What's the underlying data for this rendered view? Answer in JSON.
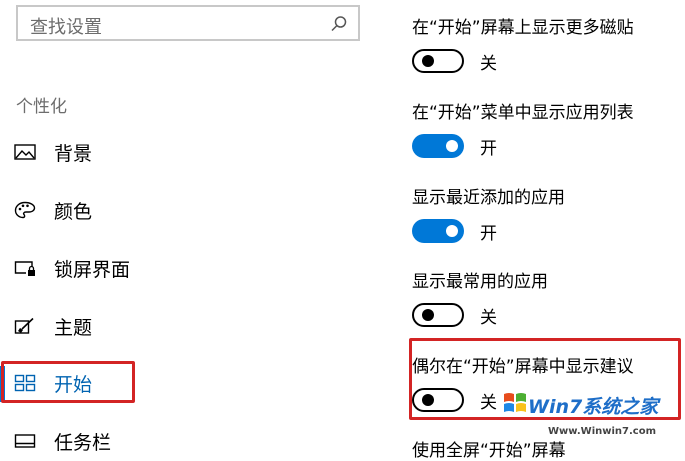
{
  "search": {
    "placeholder": "查找设置",
    "icon": "search-icon"
  },
  "sidebar": {
    "section_title": "个性化",
    "items": [
      {
        "label": "背景",
        "icon": "picture-icon"
      },
      {
        "label": "颜色",
        "icon": "palette-icon"
      },
      {
        "label": "锁屏界面",
        "icon": "lock-screen-icon"
      },
      {
        "label": "主题",
        "icon": "theme-brush-icon"
      },
      {
        "label": "开始",
        "icon": "start-tiles-icon",
        "active": true
      },
      {
        "label": "任务栏",
        "icon": "taskbar-icon"
      }
    ]
  },
  "settings": [
    {
      "label": "在“开始”屏幕上显示更多磁贴",
      "state": "关",
      "on": false
    },
    {
      "label": "在“开始”菜单中显示应用列表",
      "state": "开",
      "on": true
    },
    {
      "label": "显示最近添加的应用",
      "state": "开",
      "on": true
    },
    {
      "label": "显示最常用的应用",
      "state": "关",
      "on": false
    },
    {
      "label": "偶尔在“开始”屏幕中显示建议",
      "state": "关",
      "on": false
    },
    {
      "label": "使用全屏“开始”屏幕"
    }
  ],
  "watermark": {
    "brand": "Win7系统之家",
    "url": "Www.Winwin7.com"
  },
  "colors": {
    "accent": "#0078d7",
    "highlight": "#d32424"
  }
}
